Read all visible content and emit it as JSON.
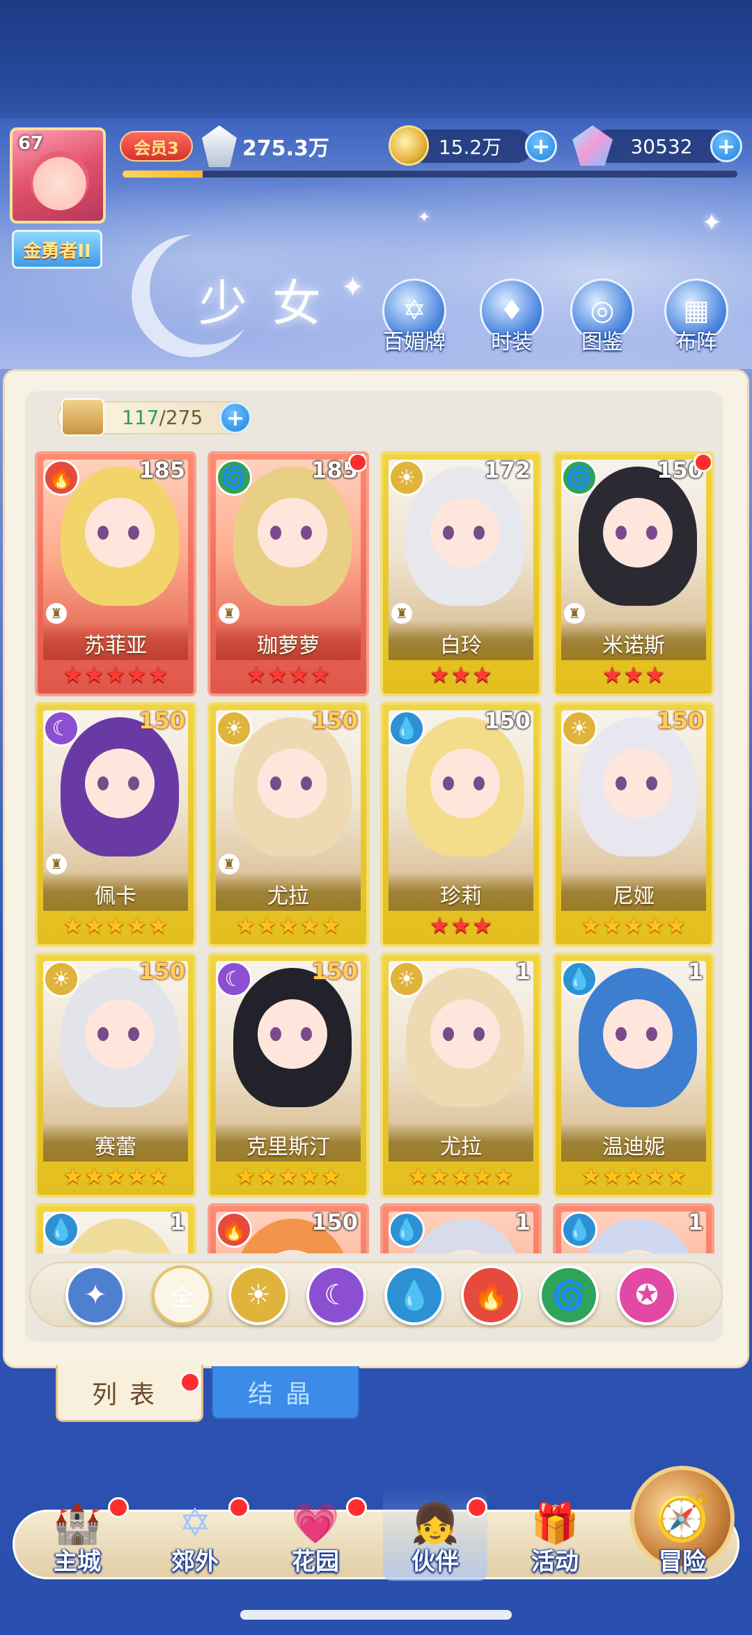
{
  "player": {
    "level": "67",
    "rank_title": "金勇者II",
    "vip_label": "会员3",
    "power": "275.3万",
    "exp_progress": 0.13
  },
  "resources": {
    "gold": "15.2万",
    "gems": "30532"
  },
  "page_title": "少女",
  "header_buttons": [
    {
      "label": "百媚牌",
      "icon": "card-deck-icon"
    },
    {
      "label": "时装",
      "icon": "outfit-icon"
    },
    {
      "label": "图鉴",
      "icon": "codex-book-icon"
    },
    {
      "label": "布阵",
      "icon": "formation-grid-icon"
    }
  ],
  "collection": {
    "current": "117",
    "separator": "/",
    "max": "275"
  },
  "cards": [
    {
      "name": "苏菲亚",
      "level": "185",
      "element": "fire",
      "rarity": "red",
      "stars": 5,
      "star_color": "red",
      "has_rook": true,
      "notify": false,
      "hair": "#f2d56a"
    },
    {
      "name": "珈萝萝",
      "level": "185",
      "element": "wind",
      "rarity": "red",
      "stars": 4,
      "star_color": "red",
      "has_rook": true,
      "notify": true,
      "hair": "#e8cf84"
    },
    {
      "name": "白玲",
      "level": "172",
      "element": "light",
      "rarity": "gold",
      "stars": 3,
      "star_color": "red",
      "has_rook": true,
      "notify": false,
      "hair": "#e6e8ee"
    },
    {
      "name": "米诺斯",
      "level": "150",
      "element": "wind",
      "rarity": "gold",
      "stars": 3,
      "star_color": "red",
      "has_rook": true,
      "notify": true,
      "hair": "#2b2a33"
    },
    {
      "name": "佩卡",
      "level": "150",
      "element": "moon",
      "rarity": "gold",
      "stars": 5,
      "star_color": "gold",
      "has_rook": true,
      "notify": false,
      "hair": "#6a3aa4",
      "level_color": "orange"
    },
    {
      "name": "尤拉",
      "level": "150",
      "element": "light",
      "rarity": "gold",
      "stars": 5,
      "star_color": "gold",
      "has_rook": true,
      "notify": false,
      "hair": "#eed9b3",
      "level_color": "orange"
    },
    {
      "name": "珍莉",
      "level": "150",
      "element": "water",
      "rarity": "gold",
      "stars": 3,
      "star_color": "red",
      "has_rook": false,
      "notify": false,
      "hair": "#f3dd8a"
    },
    {
      "name": "尼娅",
      "level": "150",
      "element": "light",
      "rarity": "gold",
      "stars": 5,
      "star_color": "gold",
      "has_rook": false,
      "notify": false,
      "hair": "#e8e6ef",
      "level_color": "orange"
    },
    {
      "name": "赛蕾",
      "level": "150",
      "element": "light",
      "rarity": "gold",
      "stars": 5,
      "star_color": "gold",
      "has_rook": false,
      "notify": false,
      "hair": "#e3e3ea",
      "level_color": "orange"
    },
    {
      "name": "克里斯汀",
      "level": "150",
      "element": "moon",
      "rarity": "gold",
      "stars": 5,
      "star_color": "gold",
      "has_rook": false,
      "notify": false,
      "hair": "#23222b",
      "level_color": "orange"
    },
    {
      "name": "尤拉",
      "level": "1",
      "element": "light",
      "rarity": "gold",
      "stars": 5,
      "star_color": "gold",
      "has_rook": false,
      "notify": false,
      "hair": "#eed9b3"
    },
    {
      "name": "温迪妮",
      "level": "1",
      "element": "water",
      "rarity": "gold",
      "stars": 5,
      "star_color": "gold",
      "has_rook": false,
      "notify": false,
      "hair": "#3d7ed0"
    },
    {
      "name": "",
      "level": "1",
      "element": "water",
      "rarity": "gold",
      "stars": 0,
      "star_color": "gold",
      "has_rook": false,
      "notify": false,
      "hair": "#f0dc9a"
    },
    {
      "name": "",
      "level": "150",
      "element": "fire",
      "rarity": "red",
      "stars": 0,
      "star_color": "red",
      "has_rook": false,
      "notify": false,
      "hair": "#f2944a"
    },
    {
      "name": "",
      "level": "1",
      "element": "water",
      "rarity": "red",
      "stars": 0,
      "star_color": "red",
      "has_rook": false,
      "notify": false,
      "hair": "#d8dcea"
    },
    {
      "name": "",
      "level": "1",
      "element": "water",
      "rarity": "red",
      "stars": 0,
      "star_color": "red",
      "has_rook": false,
      "notify": false,
      "hair": "#cfd8ee"
    }
  ],
  "filters": [
    {
      "id": "up",
      "glyph": "✦",
      "icon": "sort-up-icon"
    },
    {
      "id": "all",
      "glyph": "全",
      "icon": "all-icon"
    },
    {
      "id": "light",
      "glyph": "☀",
      "icon": "light-element-icon"
    },
    {
      "id": "moon",
      "glyph": "☾",
      "icon": "moon-element-icon"
    },
    {
      "id": "water",
      "glyph": "💧",
      "icon": "water-element-icon"
    },
    {
      "id": "fire",
      "glyph": "🔥",
      "icon": "fire-element-icon"
    },
    {
      "id": "wind",
      "glyph": "🌀",
      "icon": "wind-element-icon"
    },
    {
      "id": "star",
      "glyph": "✪",
      "icon": "star-element-icon"
    }
  ],
  "tabs": {
    "list": "列表",
    "crystal": "结晶"
  },
  "nav": [
    {
      "label": "主城",
      "icon": "castle-icon",
      "notify": true
    },
    {
      "label": "郊外",
      "icon": "portal-icon",
      "notify": true
    },
    {
      "label": "花园",
      "icon": "heart-garden-icon",
      "notify": true
    },
    {
      "label": "伙伴",
      "icon": "partner-icon",
      "notify": true,
      "active": true
    },
    {
      "label": "活动",
      "icon": "gift-icon",
      "notify": false
    },
    {
      "label": "冒险",
      "icon": "compass-icon",
      "notify": false
    }
  ],
  "colors": {
    "fire": "#e64a3c",
    "wind": "#2fa35a",
    "light": "#e0b43a",
    "moon": "#8d4fd1",
    "water": "#2d91d4",
    "accent_blue": "#1f7fe0"
  }
}
